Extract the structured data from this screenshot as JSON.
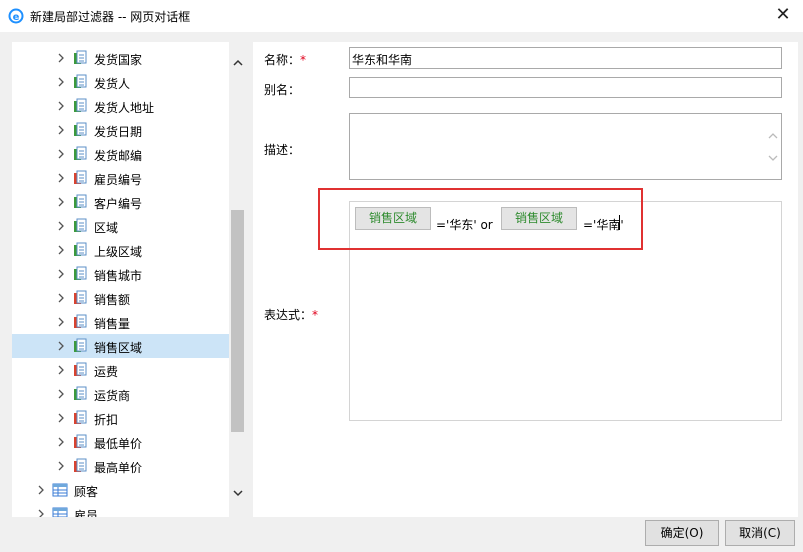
{
  "window": {
    "title": "新建局部过滤器 -- 网页对话框",
    "close_glyph": "✕"
  },
  "tree": {
    "items": [
      {
        "label": "发货国家",
        "icon": "field-green-icon",
        "level": 2
      },
      {
        "label": "发货人",
        "icon": "field-green-icon",
        "level": 2
      },
      {
        "label": "发货人地址",
        "icon": "field-green-icon",
        "level": 2
      },
      {
        "label": "发货日期",
        "icon": "field-green-icon",
        "level": 2
      },
      {
        "label": "发货邮编",
        "icon": "field-green-icon",
        "level": 2
      },
      {
        "label": "雇员编号",
        "icon": "field-red-icon",
        "level": 2
      },
      {
        "label": "客户编号",
        "icon": "field-green-icon",
        "level": 2
      },
      {
        "label": "区域",
        "icon": "field-green-icon",
        "level": 2
      },
      {
        "label": "上级区域",
        "icon": "field-green-icon",
        "level": 2
      },
      {
        "label": "销售城市",
        "icon": "field-green-icon",
        "level": 2
      },
      {
        "label": "销售额",
        "icon": "field-red-icon",
        "level": 2
      },
      {
        "label": "销售量",
        "icon": "field-red-icon",
        "level": 2
      },
      {
        "label": "销售区域",
        "icon": "field-green-icon",
        "level": 2,
        "selected": true
      },
      {
        "label": "运费",
        "icon": "field-red-icon",
        "level": 2
      },
      {
        "label": "运货商",
        "icon": "field-green-icon",
        "level": 2
      },
      {
        "label": "折扣",
        "icon": "field-red-icon",
        "level": 2
      },
      {
        "label": "最低单价",
        "icon": "field-red-icon",
        "level": 2
      },
      {
        "label": "最高单价",
        "icon": "field-red-icon",
        "level": 2
      },
      {
        "label": "顾客",
        "icon": "table-icon",
        "level": 1
      },
      {
        "label": "雇员",
        "icon": "table-icon",
        "level": 1
      }
    ]
  },
  "form": {
    "name_label": "名称：",
    "name_required": "*",
    "name_value": "华东和华南",
    "alias_label": "别名：",
    "alias_value": "",
    "desc_label": "描述：",
    "desc_value": "",
    "expr_label": "表达式：",
    "expr_required": "*"
  },
  "expression": {
    "chip1": "销售区域",
    "text1": "='华东' or",
    "chip2": "销售区域",
    "text2": "='华南'"
  },
  "buttons": {
    "ok": "确定(O)",
    "cancel": "取消(C)"
  },
  "colors": {
    "chip_text": "#2e8b2e",
    "highlight_border": "#e03131",
    "required": "#e0001b",
    "selection": "#cce4f7"
  }
}
